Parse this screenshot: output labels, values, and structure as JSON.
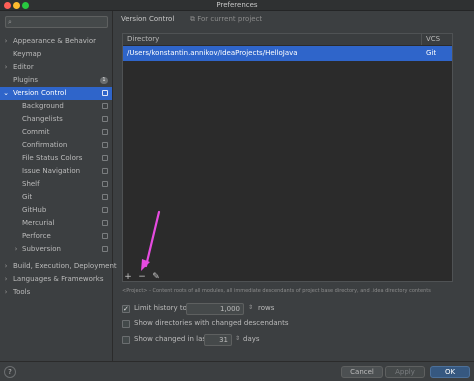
{
  "window": {
    "title": "Preferences"
  },
  "search": {
    "placeholder": ""
  },
  "sidebar": {
    "items": [
      {
        "label": "Appearance & Behavior",
        "chevron": "›",
        "level": 0
      },
      {
        "label": "Keymap",
        "chevron": "",
        "level": 0
      },
      {
        "label": "Editor",
        "chevron": "›",
        "level": 0
      },
      {
        "label": "Plugins",
        "chevron": "",
        "level": 0,
        "badge": "1"
      },
      {
        "label": "Version Control",
        "chevron": "⌄",
        "level": 0,
        "selected": true,
        "copy_icon": true
      },
      {
        "label": "Background",
        "level": 1,
        "copy_icon": true
      },
      {
        "label": "Changelists",
        "level": 1,
        "copy_icon": true
      },
      {
        "label": "Commit",
        "level": 1,
        "copy_icon": true
      },
      {
        "label": "Confirmation",
        "level": 1,
        "copy_icon": true
      },
      {
        "label": "File Status Colors",
        "level": 1,
        "copy_icon": true
      },
      {
        "label": "Issue Navigation",
        "level": 1,
        "copy_icon": true
      },
      {
        "label": "Shelf",
        "level": 1,
        "copy_icon": true
      },
      {
        "label": "Git",
        "level": 1,
        "copy_icon": true
      },
      {
        "label": "GitHub",
        "level": 1,
        "copy_icon": true
      },
      {
        "label": "Mercurial",
        "level": 1,
        "copy_icon": true
      },
      {
        "label": "Perforce",
        "level": 1,
        "copy_icon": true
      },
      {
        "label": "Subversion",
        "level": 1,
        "chevron": "›",
        "copy_icon": true
      },
      {
        "label": "Build, Execution, Deployment",
        "chevron": "›",
        "level": 0
      },
      {
        "label": "Languages & Frameworks",
        "chevron": "›",
        "level": 0
      },
      {
        "label": "Tools",
        "chevron": "›",
        "level": 0
      }
    ]
  },
  "main": {
    "breadcrumb": "Version Control",
    "scope": "For current project",
    "table": {
      "columns": [
        "Directory",
        "VCS"
      ],
      "rows": [
        {
          "directory": "/Users/konstantin.annikov/IdeaProjects/HelloJava",
          "vcs": "Git"
        }
      ]
    },
    "tools": {
      "add": "+",
      "remove": "−",
      "edit": "✎"
    },
    "hint": "<Project> - Content roots of all modules, all immediate descendants of project base directory, and .idea directory contents",
    "options": {
      "limit_history": {
        "label": "Limit history to:",
        "checked": true,
        "value": "1,000",
        "suffix": "rows"
      },
      "show_dirs": {
        "label": "Show directories with changed descendants",
        "checked": false
      },
      "show_changed": {
        "label": "Show changed in last",
        "checked": false,
        "value": "31",
        "suffix": "days"
      }
    }
  },
  "buttons": {
    "help": "?",
    "cancel": "Cancel",
    "apply": "Apply",
    "ok": "OK"
  },
  "colors": {
    "selection": "#2f65ca",
    "annotation_arrow": "#e64be0"
  }
}
